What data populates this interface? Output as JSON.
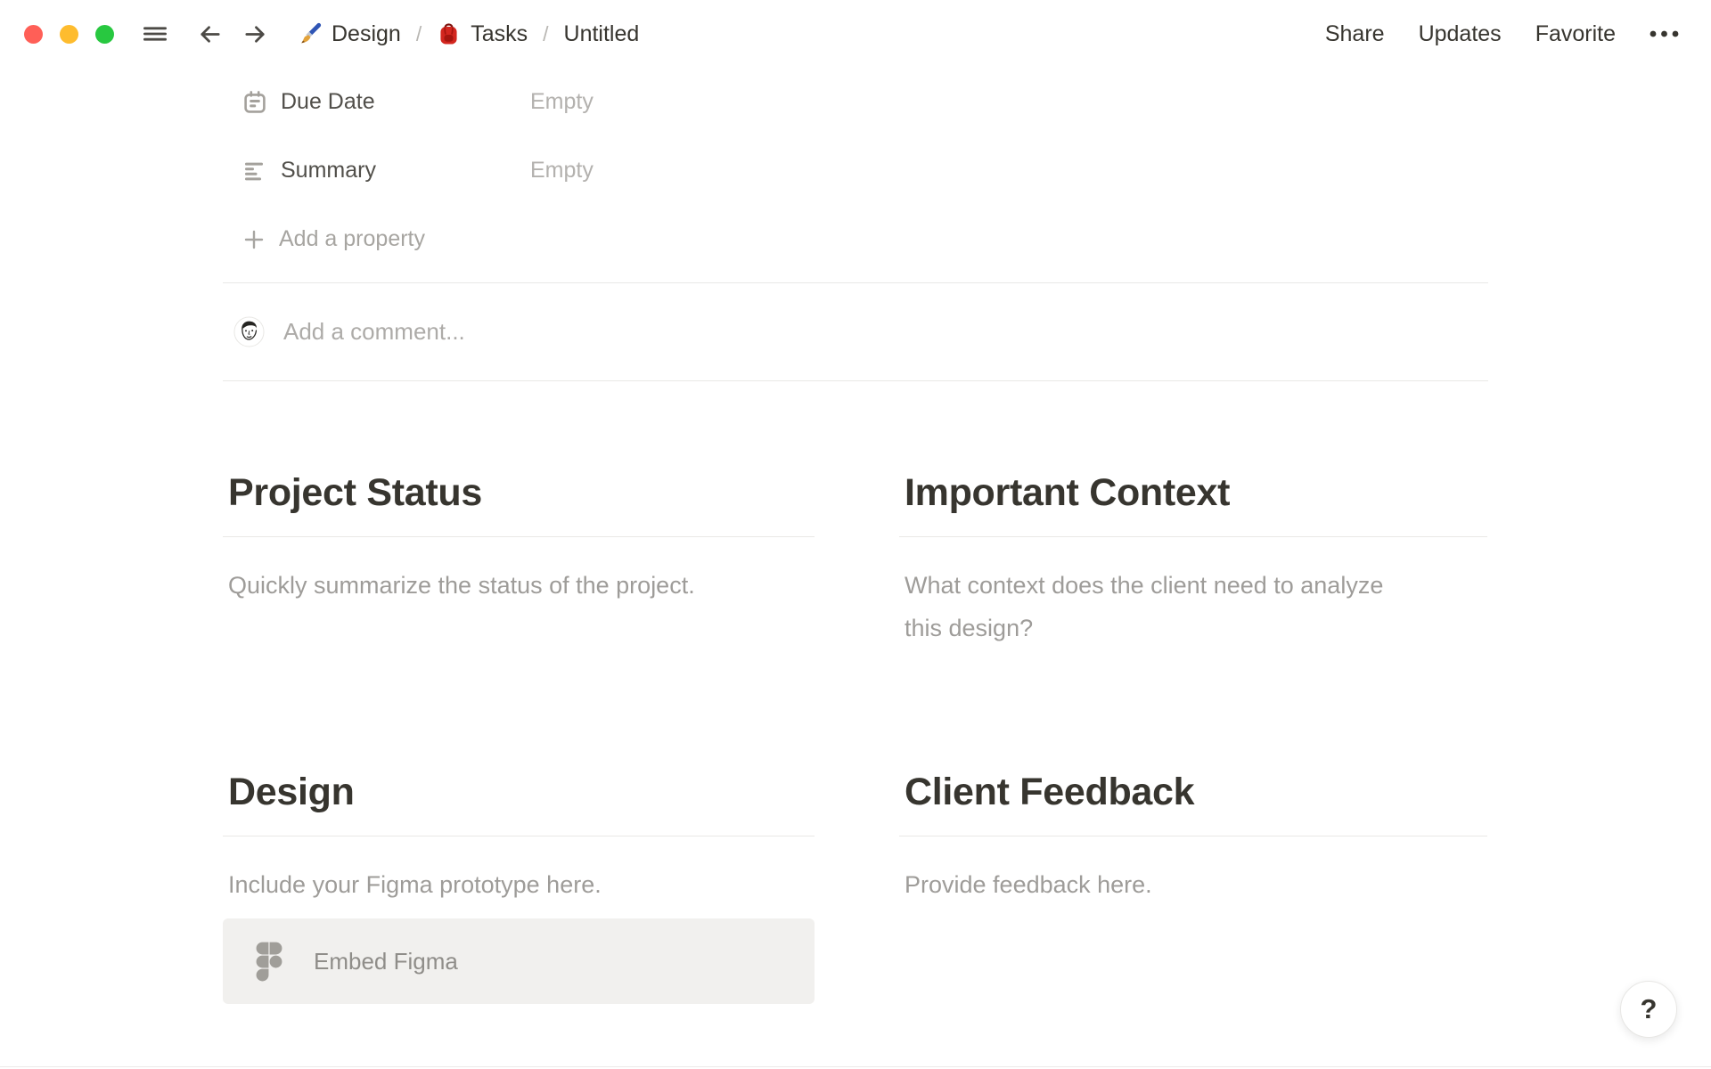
{
  "topbar": {
    "window_controls": [
      "close",
      "minimize",
      "zoom"
    ],
    "breadcrumb": {
      "items": [
        {
          "icon": "paintbrush",
          "label": "Design"
        },
        {
          "icon": "backpack",
          "label": "Tasks"
        },
        {
          "icon": "none",
          "label": "Untitled"
        }
      ],
      "separator": "/"
    },
    "actions": {
      "share": "Share",
      "updates": "Updates",
      "favorite": "Favorite",
      "more_icon": "ellipsis"
    }
  },
  "properties": {
    "rows": [
      {
        "icon": "calendar-icon",
        "label": "Due Date",
        "value": "Empty"
      },
      {
        "icon": "align-left-icon",
        "label": "Summary",
        "value": "Empty"
      }
    ],
    "add_property": "Add a property"
  },
  "comment": {
    "avatar": "user-avatar",
    "placeholder": "Add a comment..."
  },
  "sections": [
    {
      "title": "Project Status",
      "body": "Quickly summarize the status of the project."
    },
    {
      "title": "Important Context",
      "body": "What context does the client need to analyze\nthis design?"
    },
    {
      "title": "Design",
      "body": "Include your Figma prototype here.",
      "embed_button": {
        "icon": "figma-icon",
        "label": "Embed Figma"
      }
    },
    {
      "title": "Client Feedback",
      "body": "Provide feedback here."
    }
  ],
  "help_button": {
    "label": "?"
  },
  "colors": {
    "background": "#ffffff",
    "text_primary": "#37352f",
    "text_secondary": "#9e9c99",
    "text_placeholder": "#b3b1ae",
    "divider": "#e9e8e6",
    "embed_background": "#f1f0ee",
    "figma_icon_gray": "#a09e99",
    "traffic_close": "#ff5f57",
    "traffic_minimize": "#febc2e",
    "traffic_zoom": "#28c840",
    "backpack_red": "#d3261f",
    "brush_blue": "#2f55b5",
    "brush_gold": "#e2a23b"
  }
}
